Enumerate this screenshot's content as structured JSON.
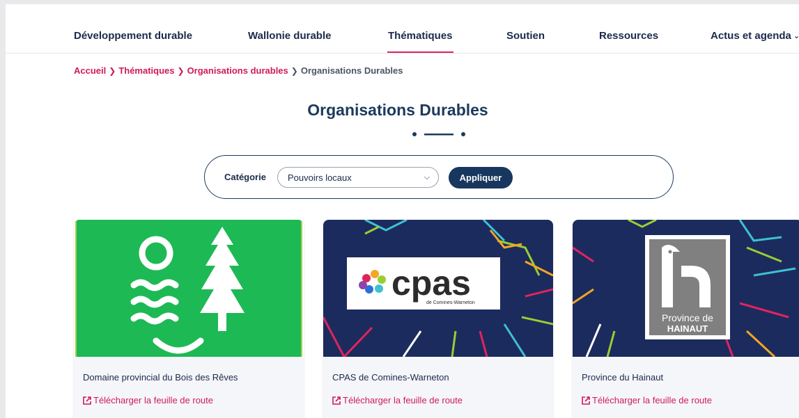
{
  "nav": {
    "items": [
      {
        "label": "Développement durable"
      },
      {
        "label": "Wallonie durable"
      },
      {
        "label": "Thématiques"
      },
      {
        "label": "Soutien"
      },
      {
        "label": "Ressources"
      },
      {
        "label": "Actus et agenda"
      }
    ],
    "active_index": 2
  },
  "breadcrumb": {
    "items": [
      "Accueil",
      "Thématiques",
      "Organisations durables"
    ],
    "current": "Organisations Durables"
  },
  "page_title": "Organisations Durables",
  "filter": {
    "label": "Catégorie",
    "selected": "Pouvoirs locaux",
    "apply_label": "Appliquer"
  },
  "cards": [
    {
      "name": "Domaine provincial du Bois des Rêves",
      "link": "Télécharger la feuille de route"
    },
    {
      "name": "CPAS de Comines-Warneton",
      "link": "Télécharger la feuille de route"
    },
    {
      "name": "Province du Hainaut",
      "link": "Télécharger la feuille de route"
    }
  ],
  "logos": {
    "cpas": {
      "text": "cpas",
      "subtext": "de Comines-Warneton"
    },
    "hainaut": {
      "line1": "Province de",
      "line2": "HAINAUT"
    }
  },
  "colors": {
    "accent": "#d0195a",
    "navy": "#17375e",
    "card_bg_dark": "#1c2b5e",
    "green": "#1db954"
  }
}
